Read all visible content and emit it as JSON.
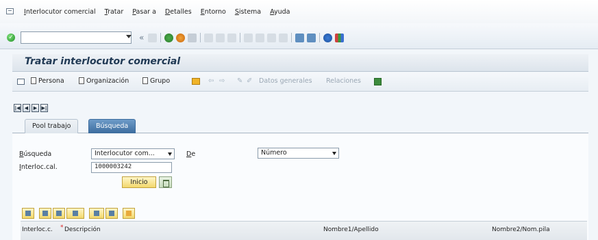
{
  "menu": {
    "items": [
      "Interlocutor comercial",
      "Tratar",
      "Pasar a",
      "Detalles",
      "Entorno",
      "Sistema",
      "Ayuda"
    ]
  },
  "toolbar": {
    "command_value": "",
    "back_label": "«"
  },
  "page": {
    "title": "Tratar interlocutor comercial"
  },
  "app_toolbar": {
    "persona_label": "Persona",
    "organizacion_label": "Organización",
    "grupo_label": "Grupo",
    "datos_generales_label": "Datos generales",
    "relaciones_label": "Relaciones"
  },
  "nav": {
    "first": "|◀",
    "prev": "◀",
    "next": "▶",
    "last": "▶|"
  },
  "tabs": [
    {
      "label": "Pool trabajo",
      "active": false
    },
    {
      "label": "Búsqueda",
      "active": true
    }
  ],
  "search": {
    "busqueda_label": "Búsqueda",
    "busqueda_value": "Interlocutor com...",
    "de_label": "De",
    "de_value": "Número",
    "interloc_label": "Interloc.cal.",
    "interloc_value": "1000003242",
    "inicio_label": "Inicio"
  },
  "result_table": {
    "columns": [
      "Interloc.c.",
      "Descripción",
      "Nombre1/Apellido",
      "Nombre2/Nom.pila"
    ],
    "required_marker": "*"
  },
  "colors": {
    "active_tab": "#3c6c9e",
    "title_text": "#213a55",
    "button_yellow": "#f3d86c"
  }
}
